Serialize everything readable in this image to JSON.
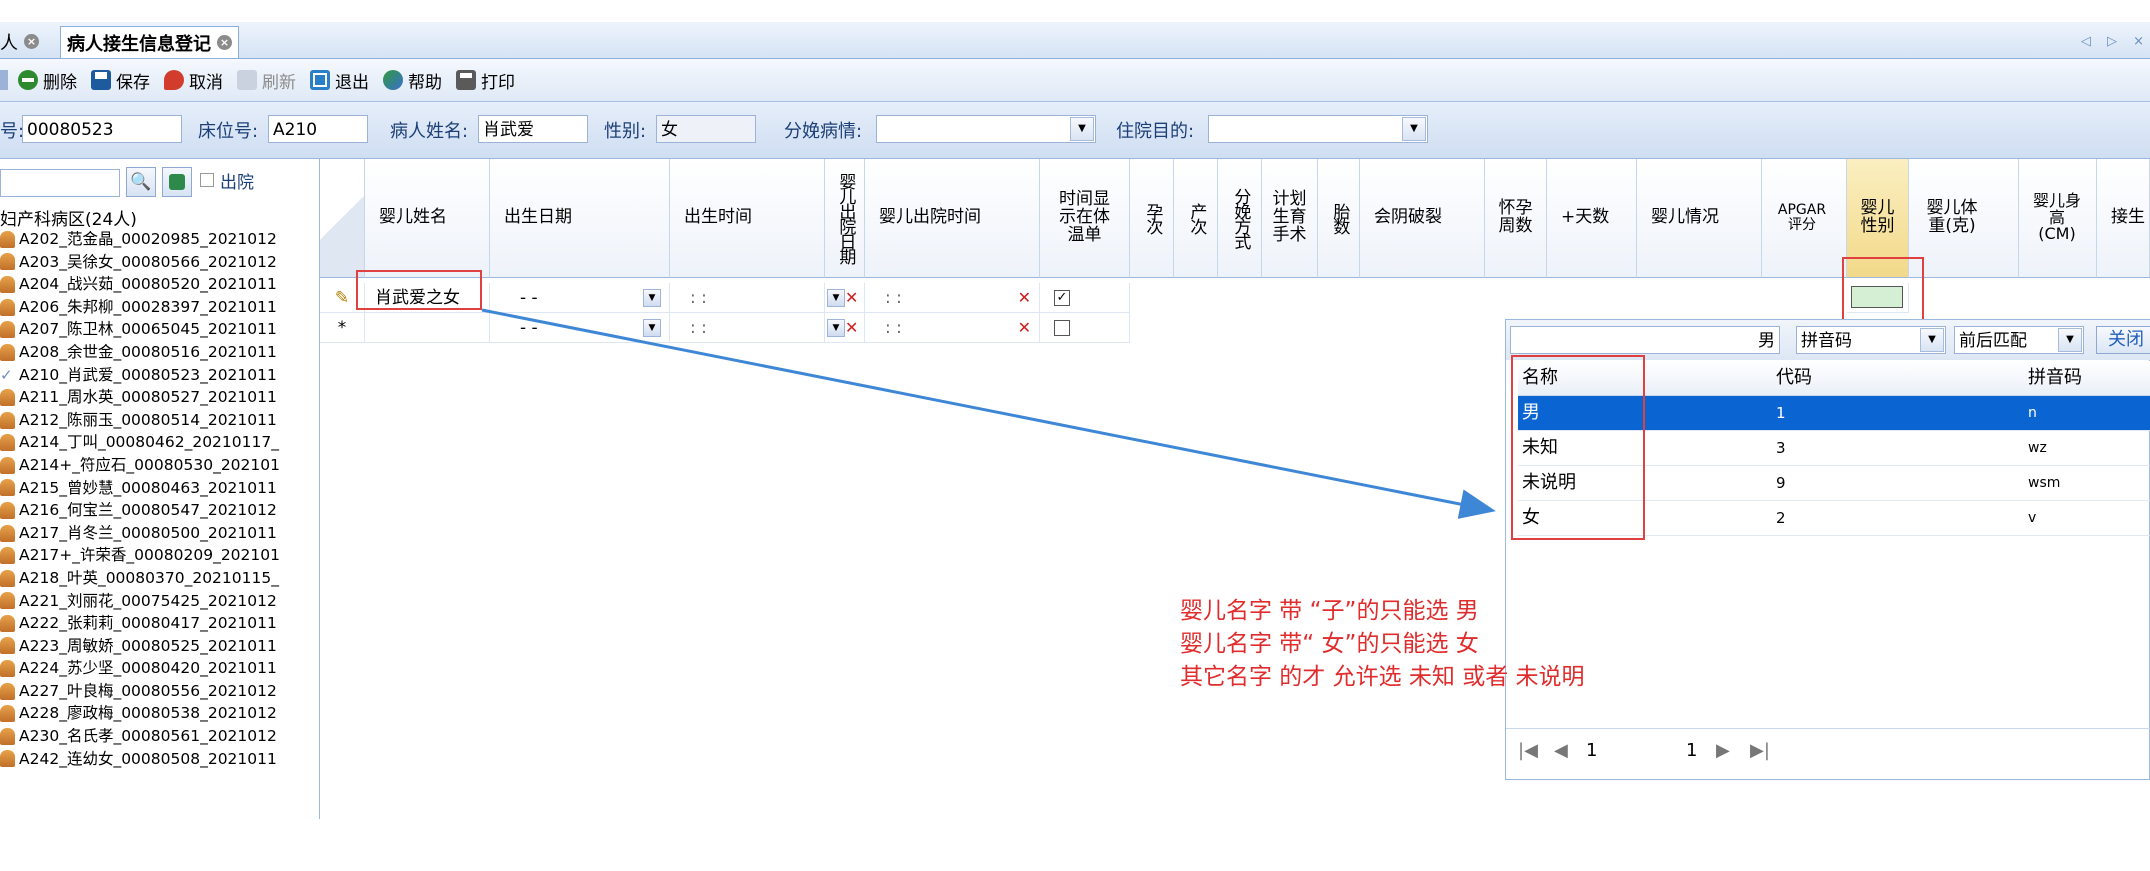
{
  "tabs": [
    {
      "label": "人",
      "active": false
    },
    {
      "label": "病人接生信息登记",
      "active": true
    }
  ],
  "tab_nav": "◁ ▷ ×",
  "toolbar": [
    {
      "label": "删除",
      "icon": "delete-icon",
      "enabled": true
    },
    {
      "label": "保存",
      "icon": "save-icon",
      "enabled": true
    },
    {
      "label": "取消",
      "icon": "undo-icon",
      "enabled": true
    },
    {
      "label": "刷新",
      "icon": "refresh-icon",
      "enabled": false
    },
    {
      "label": "退出",
      "icon": "exit-icon",
      "enabled": true
    },
    {
      "label": "帮助",
      "icon": "help-icon",
      "enabled": true
    },
    {
      "label": "打印",
      "icon": "print-icon",
      "enabled": true
    }
  ],
  "header": {
    "reg_label": "号:",
    "reg_value": "00080523",
    "bed_label": "床位号:",
    "bed_value": "A210",
    "name_label": "病人姓名:",
    "name_value": "肖武爱",
    "sex_label": "性别:",
    "sex_value": "女",
    "delivery_label": "分娩病情:",
    "delivery_value": "",
    "purpose_label": "住院目的:",
    "purpose_value": ""
  },
  "left_panel": {
    "discharge_label": "出院",
    "ward_label": "妇产科病区(24人)",
    "patients": [
      {
        "label": "A202_范金晶_00020985_2021012",
        "checked": false
      },
      {
        "label": "A203_吴徐女_00080566_2021012",
        "checked": false
      },
      {
        "label": "A204_战兴茹_00080520_2021011",
        "checked": false
      },
      {
        "label": "A206_朱邦柳_00028397_2021011",
        "checked": false
      },
      {
        "label": "A207_陈卫林_00065045_2021011",
        "checked": false
      },
      {
        "label": "A208_余世金_00080516_2021011",
        "checked": false
      },
      {
        "label": "A210_肖武爱_00080523_2021011",
        "checked": true
      },
      {
        "label": "A211_周水英_00080527_2021011",
        "checked": false
      },
      {
        "label": "A212_陈丽玉_00080514_2021011",
        "checked": false
      },
      {
        "label": "A214_丁叫_00080462_20210117_",
        "checked": false
      },
      {
        "label": "A214+_符应石_00080530_202101",
        "checked": false
      },
      {
        "label": "A215_曾妙慧_00080463_2021011",
        "checked": false
      },
      {
        "label": "A216_何宝兰_00080547_2021012",
        "checked": false
      },
      {
        "label": "A217_肖冬兰_00080500_2021011",
        "checked": false
      },
      {
        "label": "A217+_许荣香_00080209_202101",
        "checked": false
      },
      {
        "label": "A218_叶英_00080370_20210115_",
        "checked": false
      },
      {
        "label": "A221_刘丽花_00075425_2021012",
        "checked": false
      },
      {
        "label": "A222_张莉莉_00080417_2021011",
        "checked": false
      },
      {
        "label": "A223_周敏娇_00080525_2021011",
        "checked": false
      },
      {
        "label": "A224_苏少坚_00080420_2021011",
        "checked": false
      },
      {
        "label": "A227_叶良梅_00080556_2021012",
        "checked": false
      },
      {
        "label": "A228_廖政梅_00080538_2021012",
        "checked": false
      },
      {
        "label": "A230_名氏孝_00080561_2021012",
        "checked": false
      },
      {
        "label": "A242_连幼女_00080508_2021011",
        "checked": false
      }
    ]
  },
  "grid": {
    "columns": {
      "baby_name": "婴儿姓名",
      "birth_date": "出生日期",
      "birth_time": "出生时间",
      "discharge_date": "婴儿出院日期",
      "discharge_time": "婴儿出院时间",
      "show_temp": "时间显示在体温单",
      "gravida": "孕次",
      "para": "产次",
      "delivery_method": "分娩方式",
      "planned_surgery": "计划生育手术",
      "fetus_count": "胎数",
      "perineal_tear": "会阴破裂",
      "gestation_weeks": "怀孕周数",
      "plus_days": "+天数",
      "baby_condition": "婴儿情况",
      "apgar": "APGAR评分",
      "baby_sex": "婴儿性别",
      "baby_weight": "婴儿体重(克)",
      "baby_height": "婴儿身高(CM)",
      "deliverer": "接生"
    },
    "row1": {
      "indicator": "✎",
      "baby_name": "肖武爱之女",
      "birth_date": "-  -",
      "birth_time": ":  :",
      "discharge_time": ":  :",
      "show_temp_checked": true
    },
    "row2": {
      "indicator": "*",
      "birth_date": "-  -",
      "birth_time": ":  :",
      "discharge_time": ":  :",
      "show_temp_checked": false
    }
  },
  "popup": {
    "search_value": "男",
    "mode_value": "拼音码",
    "match_value": "前后匹配",
    "close_label": "关闭",
    "headers": {
      "name": "名称",
      "code": "代码",
      "pinyin": "拼音码"
    },
    "rows": [
      {
        "name": "男",
        "code": "1",
        "pinyin": "n",
        "selected": true
      },
      {
        "name": "未知",
        "code": "3",
        "pinyin": "wz",
        "selected": false
      },
      {
        "name": "未说明",
        "code": "9",
        "pinyin": "wsm",
        "selected": false
      },
      {
        "name": "女",
        "code": "2",
        "pinyin": "v",
        "selected": false
      }
    ],
    "pager": {
      "page": "1",
      "total": "1"
    }
  },
  "annotation": {
    "line1": "婴儿名字 带 “子”的只能选 男",
    "line2": "婴儿名字 带“ 女”的只能选 女",
    "line3": "其它名字 的才 允许选  未知 或者 未说明"
  },
  "colors": {
    "accent_blue": "#1f6fd0",
    "selected_row": "#0a64d2",
    "annotation_red": "#e02c2c",
    "highlight_column": "#f6e3a0",
    "arrow": "#3d87d6"
  }
}
